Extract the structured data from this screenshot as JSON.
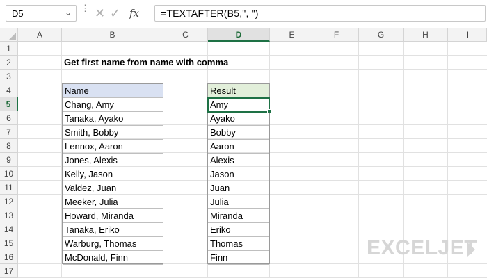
{
  "formula_bar": {
    "name_box": "D5",
    "name_box_arrow": "⌄",
    "dots": "⋮",
    "cancel_icon": "✕",
    "enter_icon": "✓",
    "fx_label": "fx",
    "formula": "=TEXTAFTER(B5,\", \")"
  },
  "columns": [
    "A",
    "B",
    "C",
    "D",
    "E",
    "F",
    "G",
    "H",
    "I"
  ],
  "active_column": "D",
  "rows": [
    "1",
    "2",
    "3",
    "4",
    "5",
    "6",
    "7",
    "8",
    "9",
    "10",
    "11",
    "12",
    "13",
    "14",
    "15",
    "16",
    "17"
  ],
  "active_row": "5",
  "sheet": {
    "title": "Get first name from name with comma",
    "name_header": "Name",
    "result_header": "Result",
    "names": [
      "Chang, Amy",
      "Tanaka, Ayako",
      "Smith, Bobby",
      "Lennox, Aaron",
      "Jones, Alexis",
      "Kelly, Jason",
      "Valdez, Juan",
      "Meeker, Julia",
      "Howard, Miranda",
      "Tanaka, Eriko",
      "Warburg, Thomas",
      "McDonald, Finn"
    ],
    "results": [
      "Amy",
      "Ayako",
      "Bobby",
      "Aaron",
      "Alexis",
      "Jason",
      "Juan",
      "Julia",
      "Miranda",
      "Eriko",
      "Thomas",
      "Finn"
    ]
  },
  "logo": {
    "text": "EXCELJET",
    "color": "#d6d6d6"
  },
  "colors": {
    "accent": "#1e7145",
    "name_header_fill": "#d9e1f2",
    "result_header_fill": "#e2efda"
  }
}
